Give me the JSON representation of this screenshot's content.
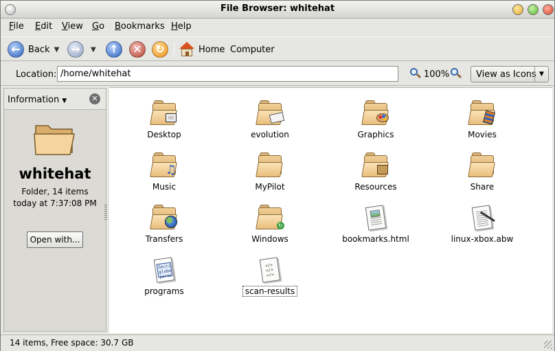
{
  "window": {
    "title": "File Browser: whitehat"
  },
  "menubar": {
    "items": [
      "File",
      "Edit",
      "View",
      "Go",
      "Bookmarks",
      "Help"
    ]
  },
  "toolbar": {
    "back_label": "Back",
    "home_label": "Home",
    "computer_label": "Computer"
  },
  "location": {
    "label": "Location:",
    "path": "/home/whitehat",
    "zoom_level": "100%",
    "view_mode": "View as Icons"
  },
  "sidebar": {
    "title": "Information",
    "folder_name": "whitehat",
    "info_line1": "Folder, 14 items",
    "info_line2": "today at 7:37:08 PM",
    "open_with_label": "Open with..."
  },
  "files": [
    {
      "name": "Desktop",
      "kind": "folder",
      "emblem": "desktop-emblem-icon"
    },
    {
      "name": "evolution",
      "kind": "folder",
      "emblem": "envelope-emblem-icon"
    },
    {
      "name": "Graphics",
      "kind": "folder",
      "emblem": "palette-emblem-icon"
    },
    {
      "name": "Movies",
      "kind": "folder",
      "emblem": "film-emblem-icon"
    },
    {
      "name": "Music",
      "kind": "folder",
      "emblem": "music-note-emblem-icon"
    },
    {
      "name": "MyPilot",
      "kind": "folder",
      "emblem": ""
    },
    {
      "name": "Resources",
      "kind": "folder",
      "emblem": "box-emblem-icon"
    },
    {
      "name": "Share",
      "kind": "folder",
      "emblem": ""
    },
    {
      "name": "Transfers",
      "kind": "folder",
      "emblem": "globe-emblem-icon"
    },
    {
      "name": "Windows",
      "kind": "folder",
      "emblem": "arrow-emblem-icon"
    },
    {
      "name": "bookmarks.html",
      "kind": "html-file"
    },
    {
      "name": "linux-xbox.abw",
      "kind": "document-file"
    },
    {
      "name": "programs",
      "kind": "text-file"
    },
    {
      "name": "scan-results",
      "kind": "code-file"
    }
  ],
  "status": {
    "text": "14 items, Free space: 30.7 GB"
  },
  "colors": {
    "folder": "#e9be7c",
    "window_bg": "#e6e6e3",
    "icon_view_bg": "#ffffff"
  }
}
